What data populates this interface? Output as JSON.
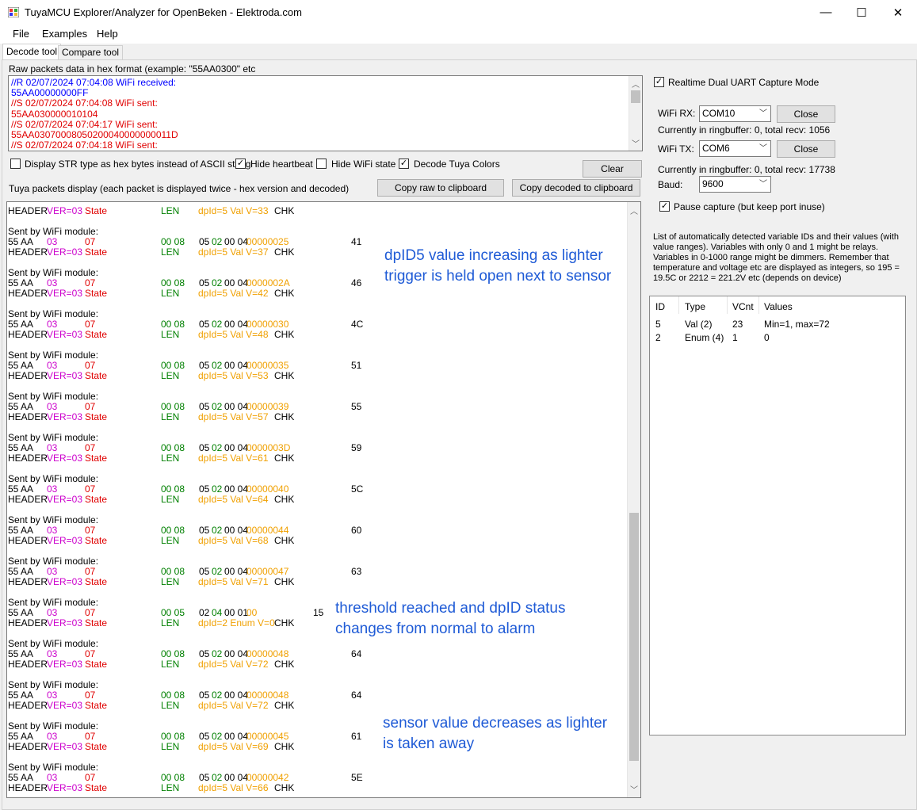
{
  "window": {
    "title": "TuyaMCU Explorer/Analyzer for OpenBeken - Elektroda.com",
    "minimize_glyph": "—",
    "maximize_glyph": "☐",
    "close_glyph": "✕"
  },
  "menu": {
    "items": [
      "File",
      "Examples",
      "Help"
    ]
  },
  "tabs": [
    "Decode tool",
    "Compare tool"
  ],
  "raw": {
    "label": "Raw packets data in hex format (example: \"55AA0300\" etc",
    "lines": [
      {
        "text": "//R 02/07/2024 07:04:08 WiFi received:",
        "color": "#0000ff"
      },
      {
        "text": "55AA00000000FF",
        "color": "#0000ff"
      },
      {
        "text": "//S 02/07/2024 07:04:08 WiFi sent:",
        "color": "#e00000"
      },
      {
        "text": "55AA030000010104",
        "color": "#e00000"
      },
      {
        "text": "//S 02/07/2024 07:04:17 WiFi sent:",
        "color": "#e00000"
      },
      {
        "text": "55AA03070008050200040000000011D",
        "color": "#e00000"
      },
      {
        "text": "//S 02/07/2024 07:04:18 WiFi sent:",
        "color": "#e00000"
      }
    ]
  },
  "options": {
    "display_str_hex": {
      "label": "Display STR type as hex bytes instead of ASCII string",
      "checked": false
    },
    "hide_heartbeat": {
      "label": "Hide heartbeat",
      "checked": true
    },
    "hide_wifi_state": {
      "label": "Hide WiFi state",
      "checked": false
    },
    "decode_colors": {
      "label": "Decode Tuya Colors",
      "checked": true
    },
    "check_glyph": "✓"
  },
  "buttons": {
    "clear": "Clear",
    "copy_raw": "Copy raw to clipboard",
    "copy_decoded": "Copy decoded to clipboard"
  },
  "packets": {
    "label": "Tuya packets display (each packet is displayed twice - hex version and decoded)",
    "top_partial": {
      "header": "HEADER",
      "ver": "VER=03",
      "state": "State",
      "len": "LEN",
      "dp": "dpId=5 Val V=33",
      "chk": "CHK"
    },
    "sent_label": "Sent by WiFi module:",
    "list": [
      {
        "header": "55 AA",
        "ver": "03",
        "cmd": "07",
        "len": "00 08",
        "dp_a": "05",
        "dp_b": "02",
        "dp_c": "00 04",
        "dp_val": "00000025",
        "chk": "41",
        "desc": "dpId=5 Val V=37"
      },
      {
        "header": "55 AA",
        "ver": "03",
        "cmd": "07",
        "len": "00 08",
        "dp_a": "05",
        "dp_b": "02",
        "dp_c": "00 04",
        "dp_val": "0000002A",
        "chk": "46",
        "desc": "dpId=5 Val V=42"
      },
      {
        "header": "55 AA",
        "ver": "03",
        "cmd": "07",
        "len": "00 08",
        "dp_a": "05",
        "dp_b": "02",
        "dp_c": "00 04",
        "dp_val": "00000030",
        "chk": "4C",
        "desc": "dpId=5 Val V=48"
      },
      {
        "header": "55 AA",
        "ver": "03",
        "cmd": "07",
        "len": "00 08",
        "dp_a": "05",
        "dp_b": "02",
        "dp_c": "00 04",
        "dp_val": "00000035",
        "chk": "51",
        "desc": "dpId=5 Val V=53"
      },
      {
        "header": "55 AA",
        "ver": "03",
        "cmd": "07",
        "len": "00 08",
        "dp_a": "05",
        "dp_b": "02",
        "dp_c": "00 04",
        "dp_val": "00000039",
        "chk": "55",
        "desc": "dpId=5 Val V=57"
      },
      {
        "header": "55 AA",
        "ver": "03",
        "cmd": "07",
        "len": "00 08",
        "dp_a": "05",
        "dp_b": "02",
        "dp_c": "00 04",
        "dp_val": "0000003D",
        "chk": "59",
        "desc": "dpId=5 Val V=61"
      },
      {
        "header": "55 AA",
        "ver": "03",
        "cmd": "07",
        "len": "00 08",
        "dp_a": "05",
        "dp_b": "02",
        "dp_c": "00 04",
        "dp_val": "00000040",
        "chk": "5C",
        "desc": "dpId=5 Val V=64"
      },
      {
        "header": "55 AA",
        "ver": "03",
        "cmd": "07",
        "len": "00 08",
        "dp_a": "05",
        "dp_b": "02",
        "dp_c": "00 04",
        "dp_val": "00000044",
        "chk": "60",
        "desc": "dpId=5 Val V=68"
      },
      {
        "header": "55 AA",
        "ver": "03",
        "cmd": "07",
        "len": "00 08",
        "dp_a": "05",
        "dp_b": "02",
        "dp_c": "00 04",
        "dp_val": "00000047",
        "chk": "63",
        "desc": "dpId=5 Val V=71"
      },
      {
        "header": "55 AA",
        "ver": "03",
        "cmd": "07",
        "len": "00 05",
        "dp_a": "02",
        "dp_b": "04",
        "dp_c": "00 01",
        "dp_val": "00",
        "chk": "15",
        "desc": "dpId=2 Enum V=0"
      },
      {
        "header": "55 AA",
        "ver": "03",
        "cmd": "07",
        "len": "00 08",
        "dp_a": "05",
        "dp_b": "02",
        "dp_c": "00 04",
        "dp_val": "00000048",
        "chk": "64",
        "desc": "dpId=5 Val V=72"
      },
      {
        "header": "55 AA",
        "ver": "03",
        "cmd": "07",
        "len": "00 08",
        "dp_a": "05",
        "dp_b": "02",
        "dp_c": "00 04",
        "dp_val": "00000048",
        "chk": "64",
        "desc": "dpId=5 Val V=72"
      },
      {
        "header": "55 AA",
        "ver": "03",
        "cmd": "07",
        "len": "00 08",
        "dp_a": "05",
        "dp_b": "02",
        "dp_c": "00 04",
        "dp_val": "00000045",
        "chk": "61",
        "desc": "dpId=5 Val V=69"
      },
      {
        "header": "55 AA",
        "ver": "03",
        "cmd": "07",
        "len": "00 08",
        "dp_a": "05",
        "dp_b": "02",
        "dp_c": "00 04",
        "dp_val": "00000042",
        "chk": "5E",
        "desc": "dpId=5 Val V=66"
      }
    ],
    "sub_labels": {
      "header": "HEADER",
      "ver": "VER=03",
      "state": "State",
      "len": "LEN",
      "chk": "CHK"
    }
  },
  "annotations": [
    {
      "lines": [
        "dpID5 value increasing as lighter",
        "trigger is held open next to sensor"
      ]
    },
    {
      "lines": [
        "threshold reached and dpID status",
        "changes from normal to alarm"
      ]
    },
    {
      "lines": [
        "sensor value decreases as lighter",
        "is taken away"
      ]
    }
  ],
  "capture": {
    "realtime_label": "Realtime Dual UART Capture Mode",
    "realtime_checked": true,
    "wifi_rx_label": "WiFi RX:",
    "wifi_rx_value": "COM10",
    "wifi_rx_button": "Close",
    "rx_status": "Currently in ringbuffer: 0, total recv: 1056",
    "wifi_tx_label": "WiFi TX:",
    "wifi_tx_value": "COM6",
    "wifi_tx_button": "Close",
    "tx_status": "Currently in ringbuffer: 0, total recv: 17738",
    "baud_label": "Baud:",
    "baud_value": "9600",
    "pause_label": "Pause capture (but keep port inuse)",
    "pause_checked": true
  },
  "variables": {
    "description": "List of automatically detected variable IDs  and their values (with value ranges). Variables with only 0 and 1 might be relays. Variables in 0-1000 range might be dimmers. Remember that temperature and voltage etc are displayed as integers, so 195 = 19.5C or 2212 = 221.2V etc (depends on device)",
    "columns": [
      "ID",
      "Type",
      "VCnt",
      "Values"
    ],
    "rows": [
      [
        "5",
        "Val (2)",
        "23",
        "Min=1, max=72"
      ],
      [
        "2",
        "Enum (4)",
        "1",
        "0"
      ]
    ]
  }
}
